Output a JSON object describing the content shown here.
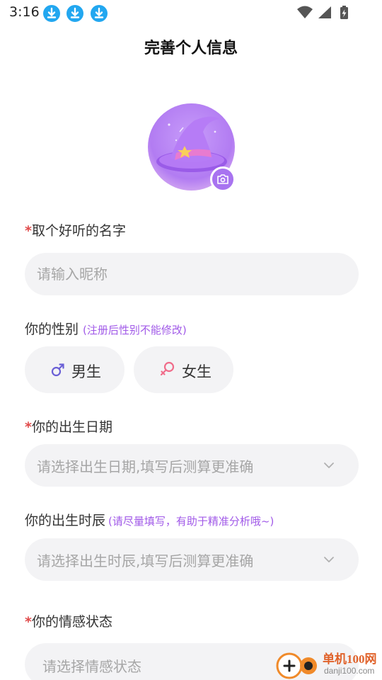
{
  "status_bar": {
    "time": "3:16"
  },
  "header": {
    "title": "完善个人信息"
  },
  "avatar": {
    "image": "witch-hat-illustration",
    "edit_icon": "camera-icon"
  },
  "nickname": {
    "required_mark": "*",
    "label": "取个好听的名字",
    "placeholder": "请输入昵称",
    "value": ""
  },
  "gender": {
    "label": "你的性别",
    "hint": "(注册后性别不能修改)",
    "options": [
      {
        "label": "男生",
        "icon": "male-symbol-icon",
        "color": "#6a5fd6"
      },
      {
        "label": "女生",
        "icon": "female-symbol-icon",
        "color": "#f06c8a"
      }
    ]
  },
  "birth_date": {
    "required_mark": "*",
    "label": "你的出生日期",
    "placeholder": "请选择出生日期,填写后测算更准确"
  },
  "birth_hour": {
    "label": "你的出生时辰",
    "hint": "(请尽量填写，有助于精准分析哦~)",
    "placeholder": "请选择出生时辰,填写后测算更准确"
  },
  "relationship": {
    "required_mark": "*",
    "label": "你的情感状态",
    "placeholder": "请选择情感状态"
  },
  "watermark": {
    "name": "单机100网",
    "url": "danji100.com"
  },
  "colors": {
    "accent": "#a15ae8",
    "required": "#e04a4a",
    "field_bg": "#f3f3f5",
    "download_badge": "#22a7f0"
  }
}
